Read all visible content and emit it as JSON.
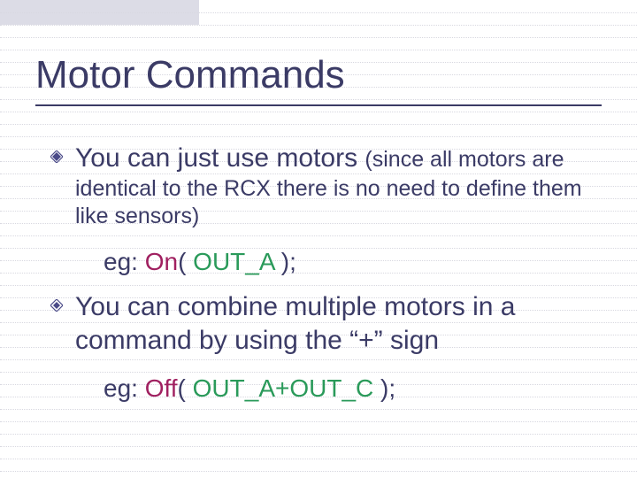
{
  "title": "Motor Commands",
  "bullet1_main": "You can just use motors ",
  "bullet1_sub": "(since all motors are identical to the RCX there is no need to define them like sensors)",
  "example1_prefix": "eg: ",
  "example1_fn": "On",
  "example1_open": "( ",
  "example1_arg": "OUT_A",
  "example1_close": " );",
  "bullet2": "You can combine multiple motors in a command by using the “+” sign",
  "example2_prefix": "eg: ",
  "example2_fn": "Off",
  "example2_open": "( ",
  "example2_arg": "OUT_A+OUT_C",
  "example2_close": " );"
}
